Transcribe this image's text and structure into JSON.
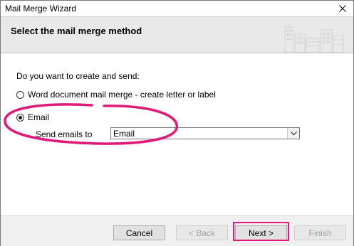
{
  "window": {
    "title": "Mail Merge Wizard",
    "close_glyph": "✕"
  },
  "header": {
    "title": "Select the mail merge method",
    "art_icon": "city-buildings-icon"
  },
  "content": {
    "question": "Do you want to create and send:",
    "option_word": "Word document mail merge - create letter or label",
    "option_email": "Email",
    "selected_option": "Email",
    "send_to_label": "Send emails to",
    "send_to_value": "Email"
  },
  "footer": {
    "cancel": "Cancel",
    "back": "< Back",
    "next": "Next >",
    "finish": "Finish"
  },
  "colors": {
    "annotation": "#e0197a",
    "header_bg": "#e9e9e9",
    "footer_bg": "#f0f0f0"
  }
}
